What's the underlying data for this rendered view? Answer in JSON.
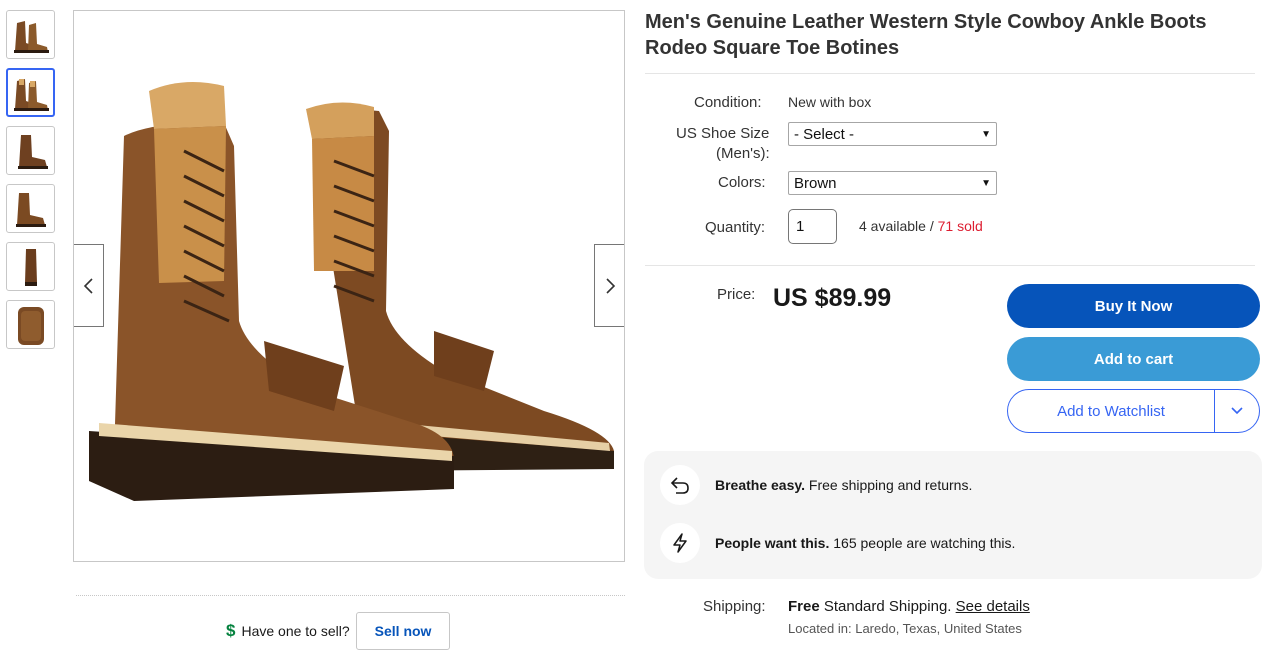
{
  "product": {
    "title": "Men's Genuine Leather Western Style Cowboy Ankle Boots Rodeo Square Toe Botines"
  },
  "gallery": {
    "thumbnail_count": 6,
    "active_index": 1,
    "prev_icon": "chevron-left-icon",
    "next_icon": "chevron-right-icon"
  },
  "sell": {
    "icon": "dollar-icon",
    "prompt": "Have one to sell?",
    "button_label": "Sell now"
  },
  "details": {
    "condition_label": "Condition:",
    "condition_value": "New with box",
    "size_label_line1": "US Shoe Size",
    "size_label_line2": "(Men's):",
    "size_selected": "- Select -",
    "colors_label": "Colors:",
    "colors_selected": "Brown",
    "quantity_label": "Quantity:",
    "quantity_value": "1",
    "available_text": "4 available /",
    "sold_text": "71 sold"
  },
  "pricing": {
    "price_label": "Price:",
    "price_value": "US $89.99"
  },
  "actions": {
    "buy_now_label": "Buy It Now",
    "add_to_cart_label": "Add to cart",
    "watchlist_label": "Add to Watchlist"
  },
  "info": {
    "row1_bold": "Breathe easy.",
    "row1_text": " Free shipping and returns.",
    "row2_bold": "People want this.",
    "row2_text": " 165 people are watching this."
  },
  "shipping": {
    "label": "Shipping:",
    "free": "Free",
    "method": " Standard Shipping. ",
    "details_link": "See details",
    "location": "Located in: Laredo, Texas, United States"
  },
  "colors": {
    "accent_blue": "#0654ba",
    "cart_blue": "#3a9bd6",
    "link_blue": "#3665f3",
    "sold_red": "#dd1e31",
    "money_green": "#05823f"
  }
}
